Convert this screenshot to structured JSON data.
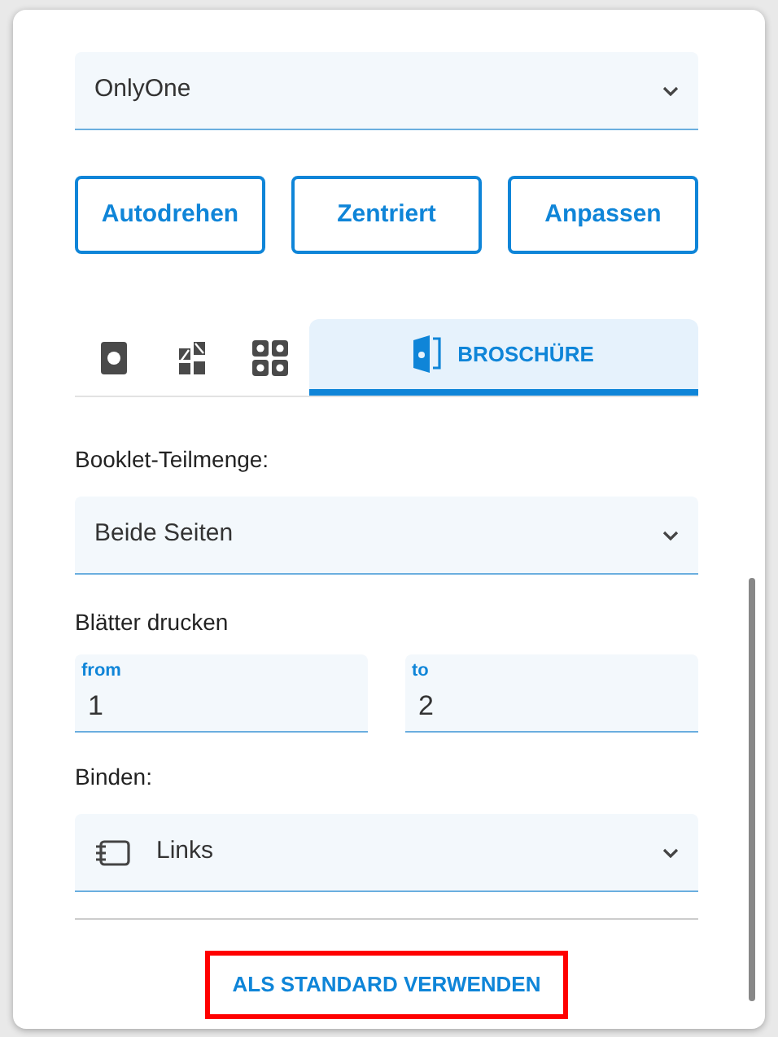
{
  "printer_select": {
    "value": "OnlyOne"
  },
  "buttons": [
    "Autodrehen",
    "Zentriert",
    "Anpassen"
  ],
  "tabs": [
    {
      "selected": false
    },
    {
      "selected": false
    },
    {
      "selected": false
    },
    {
      "label": "BROSCHÜRE",
      "selected": true
    }
  ],
  "subset": {
    "label": "Booklet-Teilmenge:",
    "value": "Beide Seiten"
  },
  "sheets": {
    "label": "Blätter drucken",
    "from": {
      "label": "from",
      "value": "1"
    },
    "to": {
      "label": "to",
      "value": "2"
    }
  },
  "binding": {
    "label": "Binden:",
    "value": "Links"
  },
  "default_button": {
    "label": "ALS STANDARD VERWENDEN",
    "highlighted": true
  }
}
